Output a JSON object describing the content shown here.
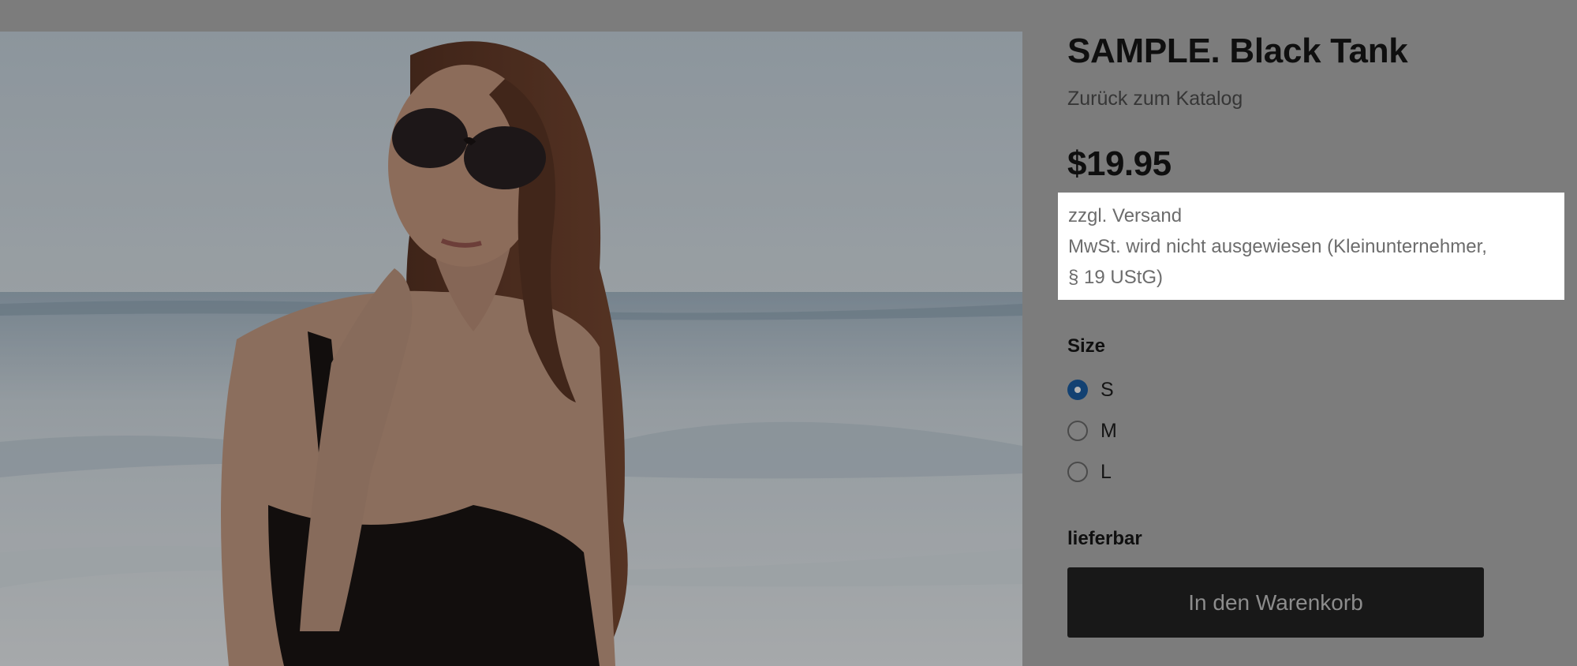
{
  "product": {
    "title": "SAMPLE. Black Tank",
    "back_link": "Zurück zum Katalog",
    "price": "$19.95",
    "image_alt": "Woman with sunglasses in a black tank top at the beach"
  },
  "notice": {
    "shipping": "zzgl. Versand",
    "tax_line1": "MwSt. wird nicht ausgewiesen (Kleinunternehmer,",
    "tax_line2": "§ 19 UStG)"
  },
  "size": {
    "label": "Size",
    "options": [
      {
        "label": "S",
        "selected": true
      },
      {
        "label": "M",
        "selected": false
      },
      {
        "label": "L",
        "selected": false
      }
    ]
  },
  "availability": "lieferbar",
  "cart_button": "In den Warenkorb",
  "colors": {
    "accent": "#1b5ea4",
    "button_bg": "#232323",
    "highlight_bg": "#ffffff"
  }
}
